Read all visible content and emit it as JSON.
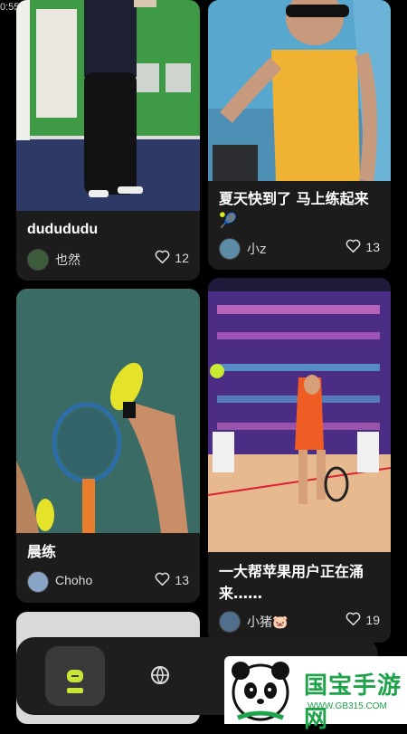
{
  "status_bar": {
    "time": "0:55"
  },
  "feed": {
    "cards": [
      {
        "title": "dudududu",
        "user": "也然",
        "likes": "12"
      },
      {
        "title": "夏天快到了 马上练起来🎾",
        "user": "小z",
        "likes": "13"
      },
      {
        "title": "晨练",
        "user": "Choho",
        "likes": "13"
      },
      {
        "title": "一大帮苹果用户正在涌来……",
        "user": "小猪🐷",
        "likes": "19"
      }
    ]
  },
  "bottom_nav": {
    "items": [
      {
        "icon": "home-icon",
        "active": true
      },
      {
        "icon": "globe-icon",
        "active": false
      }
    ]
  },
  "watermark": {
    "text": "国宝手游网",
    "url": "WWW.GB315.COM"
  },
  "colors": {
    "background": "#000000",
    "card": "#1c1c1c",
    "accent": "#c8e63a"
  }
}
